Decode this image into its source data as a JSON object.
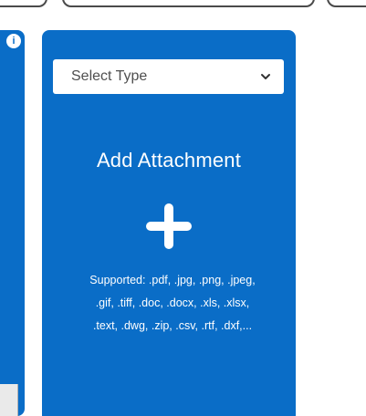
{
  "attachment_panel": {
    "type_select": {
      "selected_label": "Select Type"
    },
    "title": "Add Attachment",
    "supported_text_lines": [
      "Supported: .pdf, .jpg, .png, .jpeg,",
      ".gif, .tiff, .doc, .docx, .xls, .xlsx,",
      ".text, .dwg, .zip, .csv, .rtf, .dxf,..."
    ]
  },
  "icons": {
    "info": "info-icon",
    "dropdown": "chevron-down-icon",
    "add": "plus-icon"
  },
  "colors": {
    "card_blue": "#0a6dc7",
    "text_white": "#ffffff",
    "select_text": "#4f4f4f"
  }
}
